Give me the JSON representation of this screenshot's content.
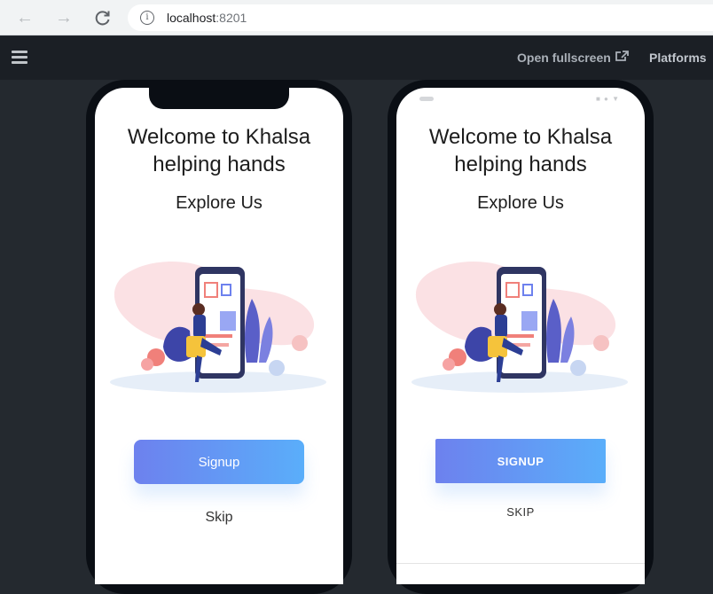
{
  "browser": {
    "url_host": "localhost",
    "url_port": ":8201",
    "back_icon": "arrow-left-icon",
    "forward_icon": "arrow-right-icon",
    "reload_icon": "reload-icon",
    "info_icon": "info-icon"
  },
  "toolbar": {
    "menu_icon": "hamburger-menu-icon",
    "open_fullscreen_label": "Open fullscreen",
    "external_icon": "external-link-icon",
    "platforms_label": "Platforms"
  },
  "ios_preview": {
    "title_line1": "Welcome to Khalsa",
    "title_line2": "helping hands",
    "subtitle": "Explore Us",
    "signup_label": "Signup",
    "skip_label": "Skip"
  },
  "android_preview": {
    "title_line1": "Welcome to Khalsa",
    "title_line2": "helping hands",
    "subtitle": "Explore Us",
    "signup_label": "SIGNUP",
    "skip_label": "SKIP"
  },
  "colors": {
    "app_bar": "#1b1f25",
    "background": "#24292f",
    "button_gradient_start": "#6d81ee",
    "button_gradient_end": "#5aaefa"
  }
}
